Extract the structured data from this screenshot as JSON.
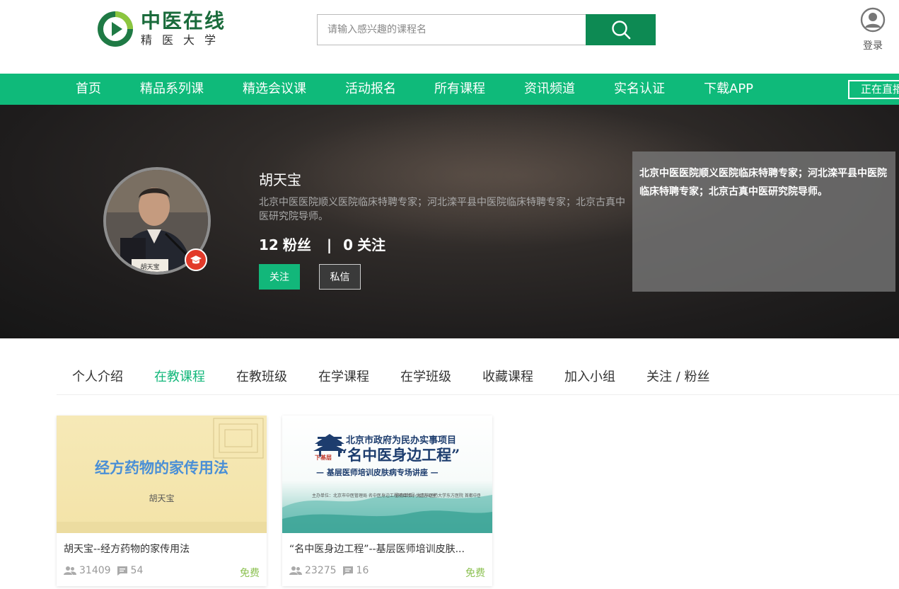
{
  "brand": {
    "title": "中医在线",
    "subtitle": "精医大学"
  },
  "search": {
    "placeholder": "请输入感兴趣的课程名"
  },
  "login": {
    "label": "登录"
  },
  "nav": {
    "items": [
      "首页",
      "精品系列课",
      "精选会议课",
      "活动报名",
      "所有课程",
      "资讯频道",
      "实名认证",
      "下载APP"
    ],
    "live": "正在直播"
  },
  "profile": {
    "name": "胡天宝",
    "description": "北京中医医院顺义医院临床特聘专家；河北滦平县中医院临床特聘专家；北京古真中医研究院导师。",
    "fans_count": "12",
    "fans_label": "粉丝",
    "separator": "|",
    "follow_count": "0",
    "follow_label": "关注",
    "follow_button": "关注",
    "message_button": "私信",
    "tooltip": "北京中医医院顺义医院临床特聘专家；河北滦平县中医院临床特聘专家；北京古真中医研究院导师。",
    "avatar_caption": "胡天宝"
  },
  "tabs": [
    {
      "label": "个人介绍",
      "active": false
    },
    {
      "label": "在教课程",
      "active": true
    },
    {
      "label": "在教班级",
      "active": false
    },
    {
      "label": "在学课程",
      "active": false
    },
    {
      "label": "在学班级",
      "active": false
    },
    {
      "label": "收藏课程",
      "active": false
    },
    {
      "label": "加入小组",
      "active": false
    },
    {
      "label": "关注 / 粉丝",
      "active": false
    }
  ],
  "courses": [
    {
      "title": "胡天宝--经方药物的家传用法",
      "thumb_title": "经方药物的家传用法",
      "thumb_author": "胡天宝",
      "students": "31409",
      "comments": "54",
      "price": "免费"
    },
    {
      "title": "“名中医身边工程”--基层医师培训皮肤...",
      "thumb_line1": "北京市政府为民办实事项目",
      "thumb_line2": "“名中医身边工程”",
      "thumb_line3": "— 基层医师培训皮肤病专场讲座 —",
      "thumb_seal": "下基层",
      "thumb_organizer": "主办单位：北京市中医管理局 名中医身边工程项目领导小组办公室",
      "thumb_host": "协办单位：北京中医药大学东方医院 首都中医青年中医培养工作委员会",
      "students": "23275",
      "comments": "16",
      "price": "免费"
    }
  ],
  "colors": {
    "brand_green": "#0fba7a",
    "search_green": "#0d8a53",
    "free_green": "#8cc152",
    "badge_red": "#e23a2a"
  }
}
